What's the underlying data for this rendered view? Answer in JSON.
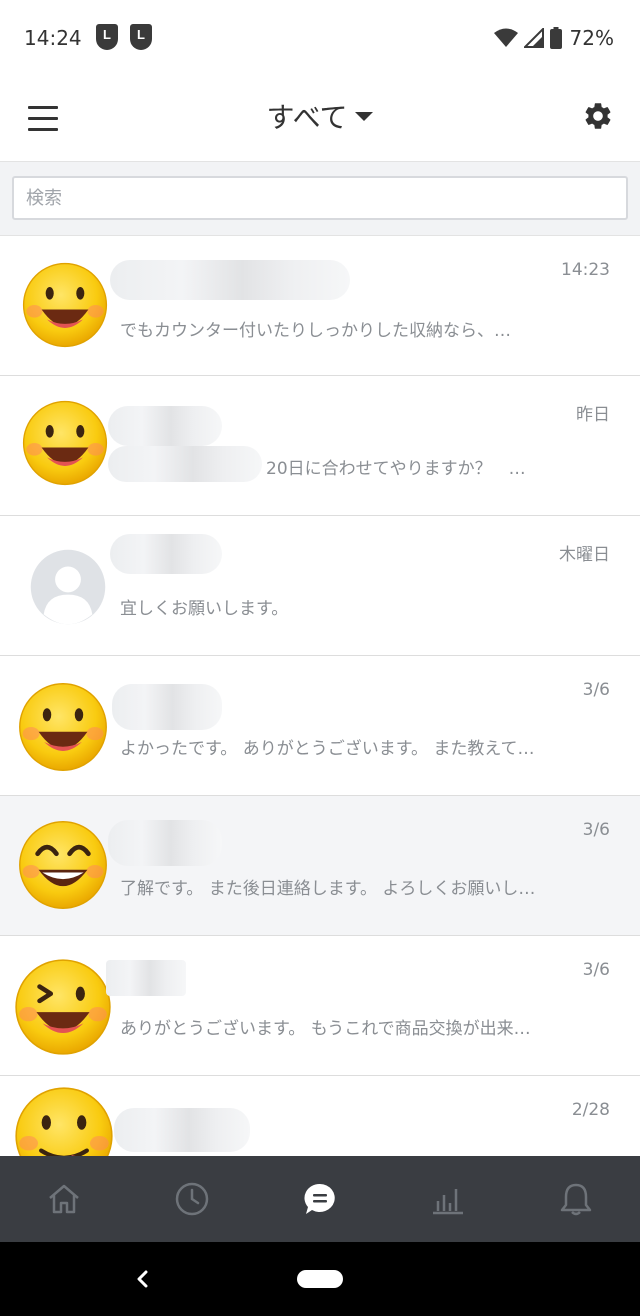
{
  "status_bar": {
    "time": "14:24",
    "badge_letter": "L",
    "battery_percent": "72%"
  },
  "header": {
    "title": "すべて",
    "menu_icon": "hamburger-menu-icon",
    "settings_icon": "gear-icon"
  },
  "search": {
    "placeholder": "検索",
    "value": ""
  },
  "chats": [
    {
      "time": "14:23",
      "preview": "でもカウンター付いたりしっかりした収納なら、…",
      "avatar": "smiley-grin-icon"
    },
    {
      "time": "昨日",
      "preview": "20日に合わせてやりますか？　…",
      "avatar": "smiley-grin-icon"
    },
    {
      "time": "木曜日",
      "preview": "宜しくお願いします。",
      "avatar": "default-person-icon"
    },
    {
      "time": "3/6",
      "preview": "よかったです。 ありがとうございます。 また教えて…",
      "avatar": "smiley-grin-icon"
    },
    {
      "time": "3/6",
      "preview": "了解です。 また後日連絡します。 よろしくお願いし…",
      "avatar": "smiley-teeth-icon"
    },
    {
      "time": "3/6",
      "preview": "ありがとうございます。 もうこれで商品交換が出来…",
      "avatar": "smiley-wink-icon"
    },
    {
      "time": "2/28",
      "preview": "",
      "avatar": "smiley-tongue-icon"
    }
  ],
  "tabs": [
    {
      "icon": "home-icon"
    },
    {
      "icon": "clock-icon"
    },
    {
      "icon": "chat-bubble-icon"
    },
    {
      "icon": "bar-chart-icon"
    },
    {
      "icon": "bell-icon"
    }
  ],
  "colors": {
    "tab_bar": "#3a3d42",
    "highlight_row": "#f4f5f7",
    "emoji_yellow": "#f7c600"
  }
}
